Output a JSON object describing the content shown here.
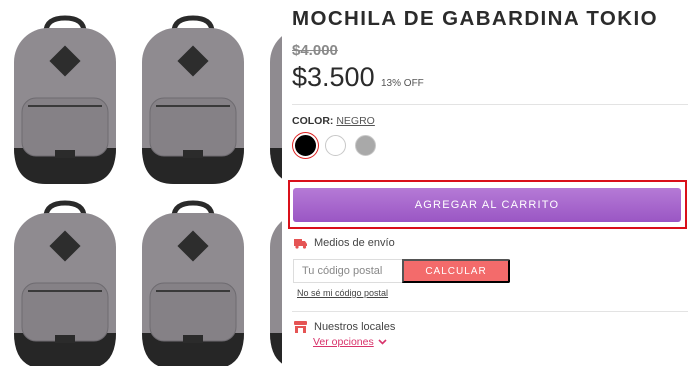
{
  "product": {
    "title": "MOCHILA DE GABARDINA TOKIO",
    "old_price": "$4.000",
    "price": "$3.500",
    "discount": "13% OFF"
  },
  "color": {
    "label": "COLOR:",
    "selected": "NEGRO",
    "swatches": [
      {
        "name": "negro",
        "hex": "#000000",
        "selected": true
      },
      {
        "name": "blanco",
        "hex": "#ffffff",
        "selected": false
      },
      {
        "name": "gris",
        "hex": "#a9a9a9",
        "selected": false
      }
    ]
  },
  "actions": {
    "add_to_cart": "AGREGAR AL CARRITO"
  },
  "shipping": {
    "title": "Medios de envío",
    "postal_placeholder": "Tu código postal",
    "calc_label": "CALCULAR",
    "dont_know": "No sé mi código postal"
  },
  "stores": {
    "title": "Nuestros locales",
    "options_link": "Ver opciones"
  },
  "colors": {
    "accent_purple": "#a566cd",
    "calc_red": "#f36b6b",
    "highlight_border": "#d9101a",
    "link_pink": "#d8336b",
    "icon_red": "#e55454"
  },
  "icons": {
    "shipping": "truck-icon",
    "stores": "store-icon",
    "options": "chevron-down-icon"
  }
}
